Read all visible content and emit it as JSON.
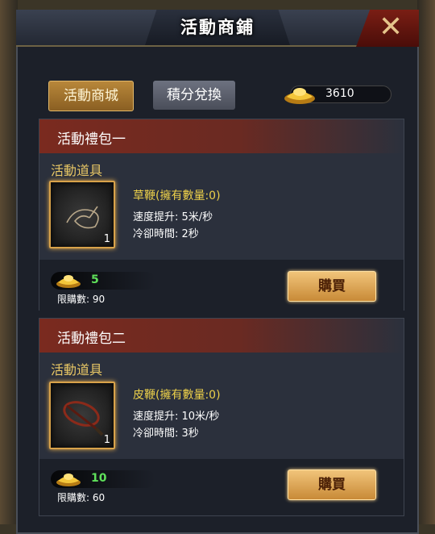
{
  "window": {
    "title": "活動商鋪",
    "close_icon": "close-x-icon"
  },
  "tabs": [
    {
      "label": "活動商城",
      "active": true
    },
    {
      "label": "積分兌換",
      "active": false
    }
  ],
  "currency": {
    "icon": "gold-ingot-icon",
    "amount": "3610"
  },
  "packs": [
    {
      "title": "活動禮包一",
      "section_label": "活動道具",
      "item_icon": "grass-whip-icon",
      "item_count": "1",
      "item_name": "草鞭(擁有數量:0)",
      "stat_speed": "速度提升:  5米/秒",
      "stat_cooldown": "冷卻時間:  2秒",
      "price": "5",
      "limit": "限購數:  90",
      "buy_label": "購買"
    },
    {
      "title": "活動禮包二",
      "section_label": "活動道具",
      "item_icon": "leather-whip-icon",
      "item_count": "1",
      "item_name": "皮鞭(擁有數量:0)",
      "stat_speed": "速度提升:  10米/秒",
      "stat_cooldown": "冷卻時間:  3秒",
      "price": "10",
      "limit": "限購數:  60",
      "buy_label": "購買"
    }
  ],
  "colors": {
    "accent_gold": "#e9c765",
    "price_green": "#5fe05a",
    "header_red": "#7a2a1f"
  }
}
